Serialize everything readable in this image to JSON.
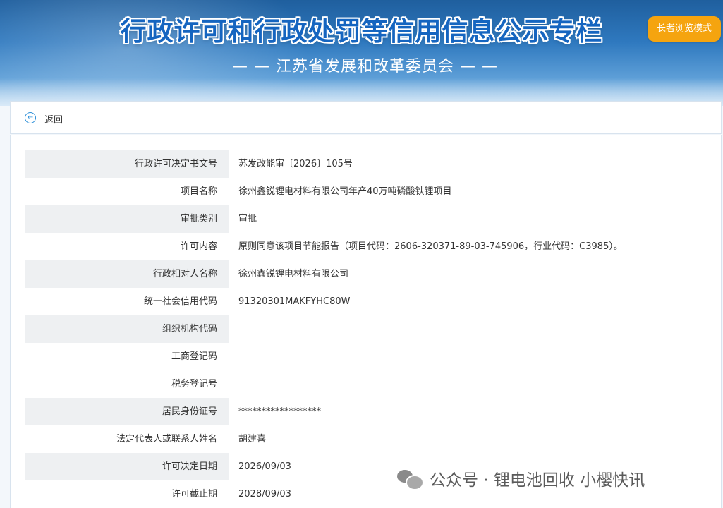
{
  "header": {
    "title": "行政许可和行政处罚等信用信息公示专栏",
    "subtitle": "— — 江苏省发展和改革委员会 — —",
    "elder_mode_label": "长者浏览模式"
  },
  "nav": {
    "back_label": "返回"
  },
  "record": {
    "rows": [
      {
        "label": "行政许可决定书文号",
        "value": "苏发改能审〔2026〕105号"
      },
      {
        "label": "项目名称",
        "value": "徐州鑫锐锂电材料有限公司年产40万吨磷酸铁锂项目"
      },
      {
        "label": "审批类别",
        "value": "审批"
      },
      {
        "label": "许可内容",
        "value": "原则同意该项目节能报告（项目代码：2606-320371-89-03-745906，行业代码：C3985）。"
      },
      {
        "label": "行政相对人名称",
        "value": "徐州鑫锐锂电材料有限公司"
      },
      {
        "label": "统一社会信用代码",
        "value": "91320301MAKFYHC80W"
      },
      {
        "label": "组织机构代码",
        "value": ""
      },
      {
        "label": "工商登记码",
        "value": ""
      },
      {
        "label": "税务登记号",
        "value": ""
      },
      {
        "label": "居民身份证号",
        "value": "******************"
      },
      {
        "label": "法定代表人或联系人姓名",
        "value": "胡建喜"
      },
      {
        "label": "许可决定日期",
        "value": "2026/09/03"
      },
      {
        "label": "许可截止期",
        "value": "2028/09/03"
      }
    ]
  },
  "watermark": {
    "text": "公众号 · 锂电池回收 小樱快讯",
    "icon": "wechat-icon"
  },
  "colors": {
    "banner_top": "#1f5f9e",
    "title_blue": "#1565c0",
    "elder_button": "#f5a40f",
    "row_shade": "#eef0f2",
    "accent": "#2c8fd8"
  }
}
